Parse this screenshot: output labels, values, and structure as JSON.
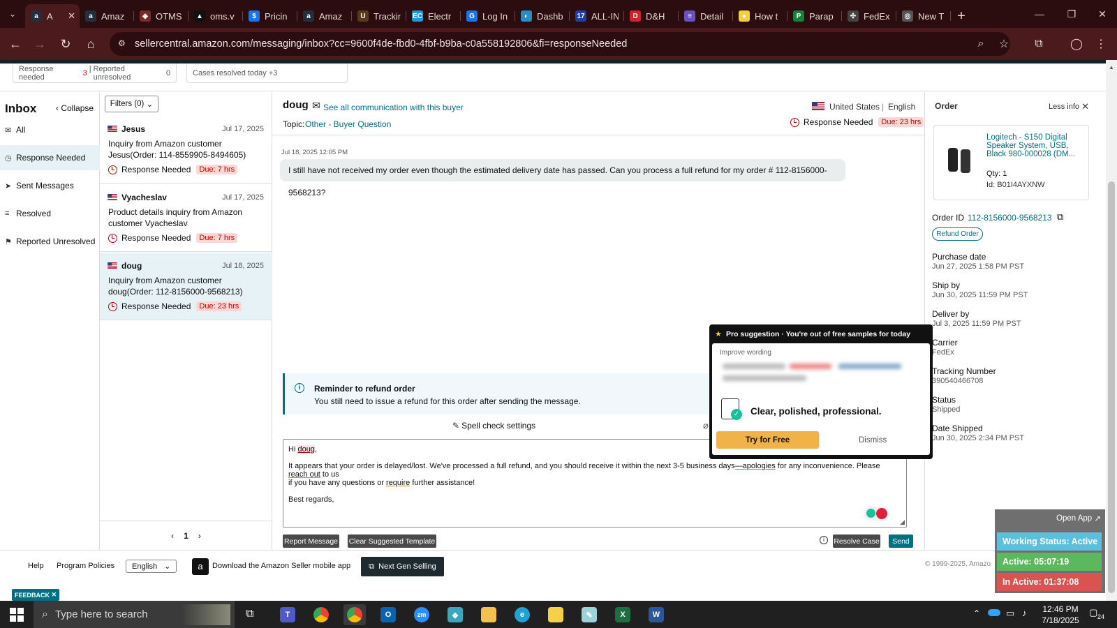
{
  "tabs": [
    {
      "title": "A",
      "fav": "a",
      "color": "#232f3e",
      "active": true
    },
    {
      "title": "Amaz",
      "fav": "a",
      "color": "#232f3e"
    },
    {
      "title": "OTMS",
      "fav": "◆",
      "color": "#7a2a2a"
    },
    {
      "title": "oms.v",
      "fav": "▲",
      "color": "#111"
    },
    {
      "title": "Pricin",
      "fav": "$",
      "color": "#1a73e8"
    },
    {
      "title": "Amaz",
      "fav": "a",
      "color": "#232f3e"
    },
    {
      "title": "Trackin",
      "fav": "U",
      "color": "#5a3a1a"
    },
    {
      "title": "Electr",
      "fav": "EC",
      "color": "#1a9ad6"
    },
    {
      "title": "Log In",
      "fav": "G",
      "color": "#1a73e8"
    },
    {
      "title": "Dashb",
      "fav": "◐",
      "color": "#2e8bc0"
    },
    {
      "title": "ALL-IN",
      "fav": "17",
      "color": "#1c3fa8"
    },
    {
      "title": "D&H",
      "fav": "D",
      "color": "#d2222d"
    },
    {
      "title": "Detail",
      "fav": "≡",
      "color": "#6b4fbb"
    },
    {
      "title": "How t",
      "fav": "●",
      "color": "#f2d23c"
    },
    {
      "title": "Parap",
      "fav": "P",
      "color": "#188038"
    },
    {
      "title": "FedEx",
      "fav": "✣",
      "color": "#444"
    },
    {
      "title": "New T",
      "fav": "◎",
      "color": "#555"
    }
  ],
  "url": "sellercentral.amazon.com/messaging/inbox?cc=9600f4de-fbd0-4fbf-b9ba-c0a558192806&fi=responseNeeded",
  "stats": {
    "response_needed_label": "Response needed",
    "response_needed_count": "3",
    "reported_unresolved_label": "Reported unresolved",
    "reported_unresolved_count": "0",
    "cases_resolved_label": "Cases resolved today",
    "cases_resolved_count": "+3"
  },
  "nav": {
    "title": "Inbox",
    "collapse": "Collapse",
    "items": [
      {
        "label": "All",
        "icon": "mail-icon"
      },
      {
        "label": "Response Needed",
        "icon": "clock-icon"
      },
      {
        "label": "Sent Messages",
        "icon": "send-icon"
      },
      {
        "label": "Resolved",
        "icon": "check-list-icon"
      },
      {
        "label": "Reported Unresolved",
        "icon": "person-flag-icon"
      }
    ]
  },
  "filters": "Filters (0)",
  "threads": [
    {
      "name": "Jesus",
      "date": "Jul 17, 2025",
      "subject": "Inquiry from Amazon customer Jesus(Order: 114-8559905-8494605)",
      "status": "Response Needed",
      "due": "Due: 7 hrs"
    },
    {
      "name": "Vyacheslav",
      "date": "Jul 17, 2025",
      "subject": "Product details inquiry from Amazon customer Vyacheslav",
      "status": "Response Needed",
      "due": "Due: 7 hrs"
    },
    {
      "name": "doug",
      "date": "Jul 18, 2025",
      "subject": "Inquiry from Amazon customer doug(Order: 112-8156000-9568213)",
      "status": "Response Needed",
      "due": "Due: 23 hrs"
    }
  ],
  "pager": {
    "page": "1"
  },
  "conversation": {
    "buyer": "doug",
    "see_all": "See all communication with this buyer",
    "country": "United States",
    "language": "English",
    "topic_label": "Topic:",
    "topic": "Other - Buyer Question",
    "status": "Response Needed",
    "due": "Due: 23 hrs",
    "timestamp": "Jul 18, 2025 12:05 PM",
    "message": "I still have not received my order even though the estimated delivery date has passed. Can you process a full refund for my order # 112-8156000-9568213?",
    "reminder_title": "Reminder to refund order",
    "reminder_text": "You still need to issue a refund for this order after sending the message.",
    "spell_check": "Spell check settings",
    "reply_hi": "Hi ",
    "reply_name": "doug",
    "reply_comma": ",",
    "reply_p1a": "It appears that your order is delayed/lost. We've processed a full refund, and you should receive it within the next 3-5 business days",
    "reply_p1b": "—apologies",
    "reply_p1c": " for any inconvenience. Please ",
    "reply_p1d": "reach out",
    "reply_p1e": " to us",
    "reply_p2a": "if you have any questions or ",
    "reply_p2b": "require",
    "reply_p2c": " further assistance!",
    "reply_sign": "Best regards,",
    "report_btn": "Report Message",
    "clear_btn": "Clear Suggested Template",
    "resolve_btn": "Resolve Case",
    "send_btn": "Send"
  },
  "order": {
    "title": "Order",
    "less_info": "Less info",
    "product": "Logitech - S150 Digital Speaker System, USB, Black 980-000028 (DM...",
    "qty": "Qty: 1",
    "id": "Id: B01I4AYXNW",
    "order_id_label": "Order ID",
    "order_id": "112-8156000-9568213",
    "refund_btn": "Refund Order",
    "fields": [
      {
        "label": "Purchase date",
        "value": "Jun 27, 2025 1:58 PM PST"
      },
      {
        "label": "Ship by",
        "value": "Jun 30, 2025 11:59 PM PST"
      },
      {
        "label": "Deliver by",
        "value": "Jul 3, 2025 11:59 PM PST"
      },
      {
        "label": "Carrier",
        "value": "FedEx"
      },
      {
        "label": "Tracking Number",
        "value": "390540466708"
      },
      {
        "label": "Status",
        "value": "Shipped"
      },
      {
        "label": "Date Shipped",
        "value": "Jun 30, 2025 2:34 PM PST"
      }
    ]
  },
  "popup": {
    "header": "Pro suggestion · You're out of free samples for today",
    "improve": "Improve wording",
    "headline": "Clear, polished, professional.",
    "try_btn": "Try for Free",
    "dismiss": "Dismiss"
  },
  "footer": {
    "help": "Help",
    "policies": "Program Policies",
    "language": "English",
    "mobile": "Download the Amazon Seller mobile app",
    "next_gen": "Next Gen Selling",
    "copyright": "© 1999-2025, Amazo",
    "feedback": "FEEDBACK"
  },
  "work_status": {
    "open_app": "Open App",
    "working": "Working Status: Active",
    "active": "Active: 05:07:19",
    "inactive": "In Active: 01:37:08"
  },
  "taskbar": {
    "search": "Type here to search",
    "time": "12:46 PM",
    "date": "7/18/2025",
    "notif": "24"
  },
  "colors": {
    "accent": "#007185",
    "alert": "#c40000",
    "browser_bg": "#2b0d10",
    "green_status": "#5cb85c",
    "red_status": "#d9534f"
  }
}
